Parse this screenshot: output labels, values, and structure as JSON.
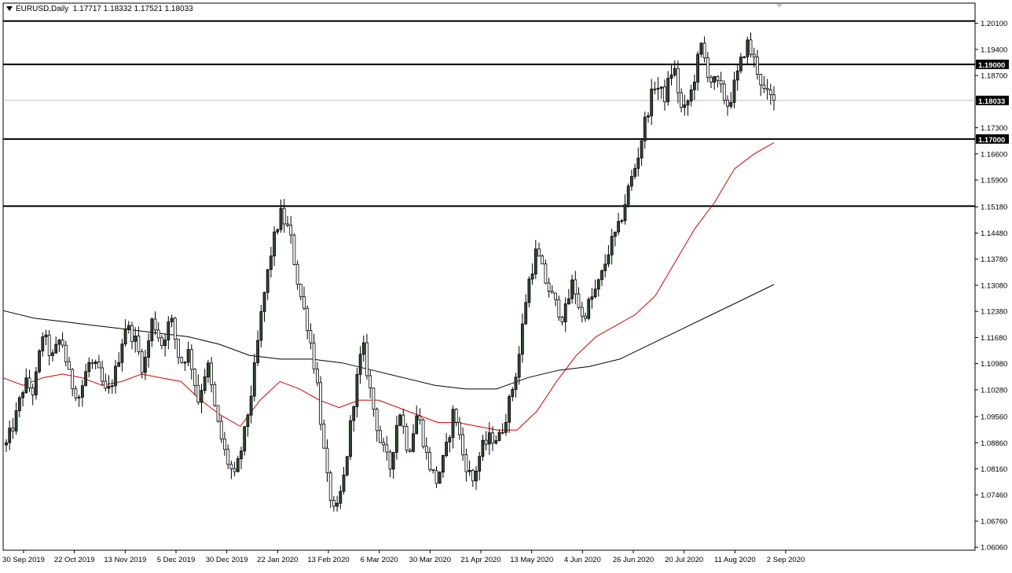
{
  "header": {
    "symbol": "EURUSD,Daily",
    "ohlc": "1.17717 1.18332 1.17521 1.18033"
  },
  "chart_data": {
    "type": "candlestick",
    "symbol": "EURUSD",
    "timeframe": "Daily",
    "last_price": "1.18033",
    "ylim": [
      1.0598,
      1.2064
    ],
    "y_ticks": [
      "1.20100",
      "1.19400",
      "1.18700",
      "1.17300",
      "1.16600",
      "1.15900",
      "1.15180",
      "1.14480",
      "1.13780",
      "1.13080",
      "1.12380",
      "1.11680",
      "1.10980",
      "1.10280",
      "1.09560",
      "1.08860",
      "1.08160",
      "1.07460",
      "1.06760",
      "1.06060"
    ],
    "x_ticks": [
      "30 Sep 2019",
      "22 Oct 2019",
      "13 Nov 2019",
      "5 Dec 2019",
      "30 Dec 2019",
      "22 Jan 2020",
      "13 Feb 2020",
      "6 Mar 2020",
      "30 Mar 2020",
      "21 Apr 2020",
      "13 May 2020",
      "4 Jun 2020",
      "26 Jun 2020",
      "20 Jul 2020",
      "11 Aug 2020",
      "2 Sep 2020"
    ],
    "horizontal_levels": [
      {
        "value": 1.2016,
        "label": ""
      },
      {
        "value": 1.19,
        "label": "1.19000"
      },
      {
        "value": 1.17,
        "label": "1.17000"
      },
      {
        "value": 1.152,
        "label": ""
      }
    ],
    "price_path": [
      1.088,
      1.095,
      1.105,
      1.102,
      1.118,
      1.111,
      1.117,
      1.105,
      1.101,
      1.11,
      1.108,
      1.101,
      1.108,
      1.12,
      1.117,
      1.108,
      1.122,
      1.115,
      1.122,
      1.11,
      1.113,
      1.1,
      1.11,
      1.095,
      1.085,
      1.079,
      1.09,
      1.105,
      1.125,
      1.14,
      1.15,
      1.145,
      1.13,
      1.12,
      1.105,
      1.08,
      1.068,
      1.08,
      1.1,
      1.115,
      1.1,
      1.088,
      1.082,
      1.098,
      1.086,
      1.097,
      1.085,
      1.078,
      1.085,
      1.098,
      1.085,
      1.078,
      1.087,
      1.09,
      1.09,
      1.099,
      1.11,
      1.13,
      1.14,
      1.132,
      1.126,
      1.122,
      1.132,
      1.122,
      1.127,
      1.132,
      1.141,
      1.146,
      1.156,
      1.164,
      1.176,
      1.185,
      1.181,
      1.19,
      1.176,
      1.183,
      1.195,
      1.186,
      1.184,
      1.179,
      1.187,
      1.196,
      1.19,
      1.182,
      1.1803
    ],
    "series": [
      {
        "name": "",
        "color": "#d00000",
        "values": [
          1.106,
          1.104,
          1.106,
          1.107,
          1.106,
          1.104,
          1.105,
          1.107,
          1.106,
          1.105,
          1.1,
          1.096,
          1.093,
          1.1,
          1.105,
          1.103,
          1.1,
          1.098,
          1.1,
          1.1,
          1.098,
          1.096,
          1.094,
          1.094,
          1.093,
          1.092,
          1.092,
          1.097,
          1.105,
          1.112,
          1.117,
          1.12,
          1.123,
          1.128,
          1.137,
          1.146,
          1.153,
          1.162,
          1.166,
          1.169
        ]
      },
      {
        "name": "",
        "color": "#000000",
        "values": [
          1.124,
          1.122,
          1.121,
          1.12,
          1.119,
          1.118,
          1.117,
          1.115,
          1.112,
          1.111,
          1.111,
          1.11,
          1.108,
          1.106,
          1.104,
          1.103,
          1.103,
          1.106,
          1.108,
          1.109,
          1.111,
          1.115,
          1.119,
          1.123,
          1.127,
          1.131
        ]
      }
    ],
    "grid": false
  }
}
